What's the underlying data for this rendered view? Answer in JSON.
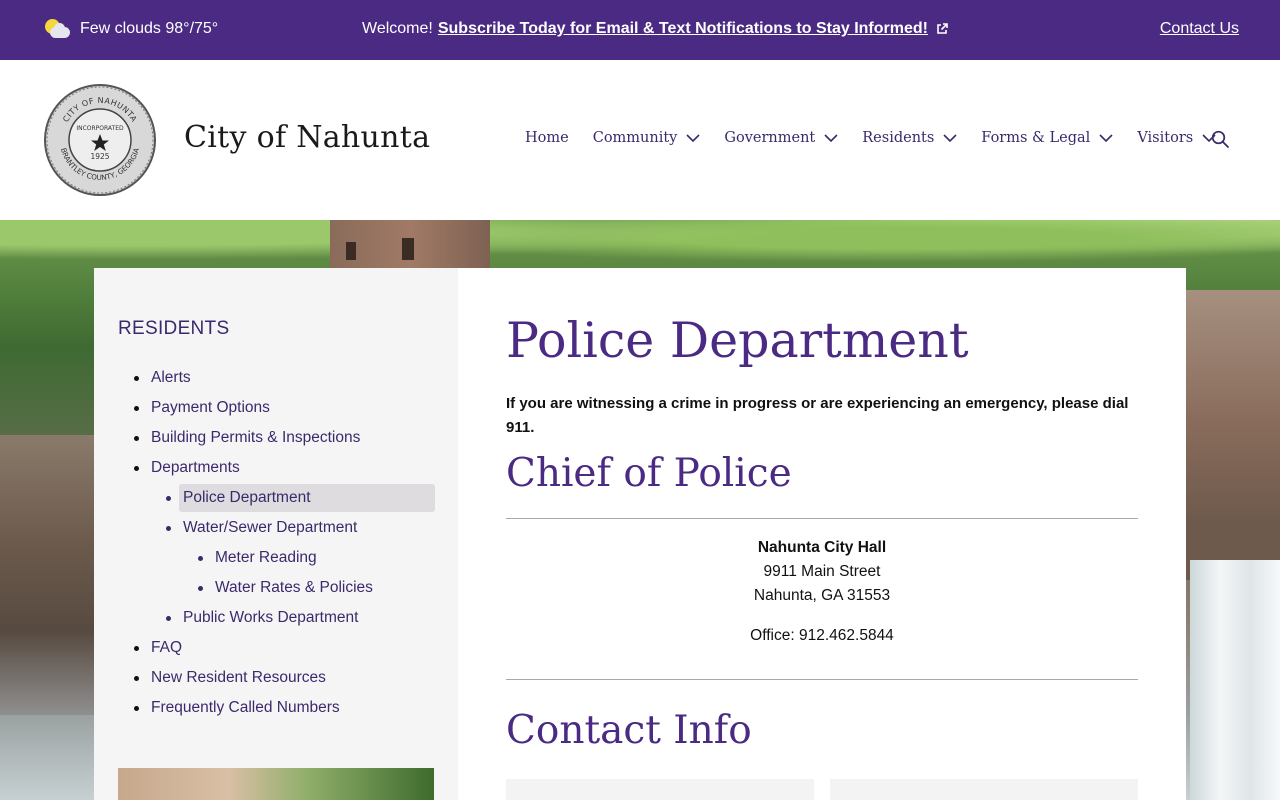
{
  "topbar": {
    "weather": "Few clouds 98°/75°",
    "welcome_prefix": "Welcome!",
    "subscribe_link": "Subscribe Today for Email & Text Notifications to Stay Informed!",
    "contact_link": "Contact Us"
  },
  "header": {
    "site_name": "City of Nahunta",
    "seal": {
      "top_text": "CITY OF NAHUNTA",
      "bottom_text": "BRANTLEY COUNTY, GEORGIA",
      "inc": "INCORPORATED",
      "year": "1925"
    },
    "nav": [
      {
        "label": "Home",
        "has_dropdown": false
      },
      {
        "label": "Community",
        "has_dropdown": true
      },
      {
        "label": "Government",
        "has_dropdown": true
      },
      {
        "label": "Residents",
        "has_dropdown": true
      },
      {
        "label": "Forms & Legal",
        "has_dropdown": true
      },
      {
        "label": "Visitors",
        "has_dropdown": true
      }
    ]
  },
  "sidebar": {
    "heading": "RESIDENTS",
    "items": [
      {
        "label": "Alerts"
      },
      {
        "label": "Payment Options"
      },
      {
        "label": "Building Permits & Inspections"
      },
      {
        "label": "Departments"
      },
      {
        "label": "Police Department"
      },
      {
        "label": "Water/Sewer Department"
      },
      {
        "label": "Meter Reading"
      },
      {
        "label": "Water Rates & Policies"
      },
      {
        "label": "Public Works Department"
      },
      {
        "label": "FAQ"
      },
      {
        "label": "New Resident Resources"
      },
      {
        "label": "Frequently Called Numbers"
      }
    ]
  },
  "main": {
    "title": "Police Department",
    "alert": "If you are witnessing a crime in progress or are experiencing an emergency, please dial 911.",
    "chief_heading": "Chief of Police",
    "address": {
      "name": "Nahunta City Hall",
      "street": "9911 Main Street",
      "city": "Nahunta, GA 31553",
      "office": "Office: 912.462.5844"
    },
    "contact_heading": "Contact Info"
  },
  "colors": {
    "brand_purple": "#4a2a82",
    "link_purple": "#3b2a6b"
  }
}
